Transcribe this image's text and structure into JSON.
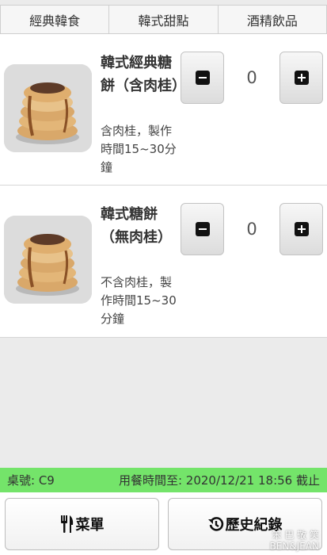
{
  "tabs": [
    {
      "label": "經典韓食"
    },
    {
      "label": "韓式甜點"
    },
    {
      "label": "酒精飲品"
    }
  ],
  "items": [
    {
      "title": "韓式經典糖餅（含肉桂）",
      "desc": "含肉桂，製作時間15~30分鐘",
      "qty": "0"
    },
    {
      "title": "韓式糖餅（無肉桂）",
      "desc": "不含肉桂，製作時間15~30分鐘",
      "qty": "0"
    }
  ],
  "status": {
    "table": "桌號: C9",
    "time": "用餐時間至: 2020/12/21 18:56 截止",
    "color": "#74e46a"
  },
  "footer": {
    "menu_label": "菜單",
    "menu_icon": "fork-knife-icon",
    "history_label": "歷史紀錄",
    "history_icon": "history-icon"
  },
  "watermark": {
    "line1": "笨 巴 敬 笑",
    "line2": "BEN&JEAN"
  }
}
